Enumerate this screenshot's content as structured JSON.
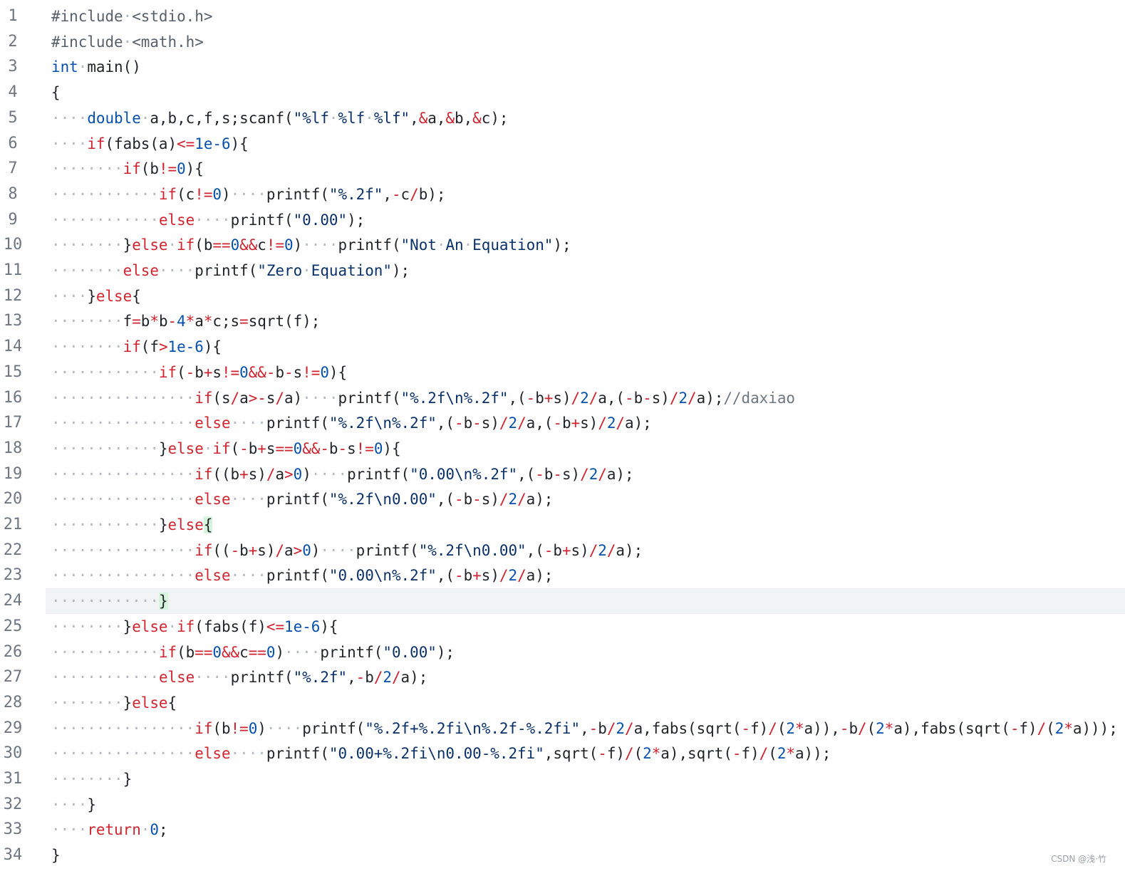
{
  "editor": {
    "highlighted_line": 24,
    "lines": [
      "#include <stdio.h>",
      "#include <math.h>",
      "int main()",
      "{",
      "    double a,b,c,f,s;scanf(\"%lf %lf %lf\",&a,&b,&c);",
      "    if(fabs(a)<=1e-6){",
      "        if(b!=0){",
      "            if(c!=0)    printf(\"%.2f\",-c/b);",
      "            else    printf(\"0.00\");",
      "        }else if(b==0&&c!=0)    printf(\"Not An Equation\");",
      "        else    printf(\"Zero Equation\");",
      "    }else{",
      "        f=b*b-4*a*c;s=sqrt(f);",
      "        if(f>1e-6){",
      "            if(-b+s!=0&&-b-s!=0){",
      "                if(s/a>-s/a)    printf(\"%.2f\\n%.2f\",(-b+s)/2/a,(-b-s)/2/a);//daxiao",
      "                else    printf(\"%.2f\\n%.2f\",(-b-s)/2/a,(-b+s)/2/a);",
      "            }else if(-b+s==0&&-b-s!=0){",
      "                if((b+s)/a>0)    printf(\"0.00\\n%.2f\",(-b-s)/2/a);",
      "                else    printf(\"%.2f\\n0.00\",(-b-s)/2/a);",
      "            }else{",
      "                if((-b+s)/a>0)    printf(\"%.2f\\n0.00\",(-b+s)/2/a);",
      "                else    printf(\"0.00\\n%.2f\",(-b+s)/2/a);",
      "            }",
      "        }else if(fabs(f)<=1e-6){",
      "            if(b==0&&c==0)    printf(\"0.00\");",
      "            else    printf(\"%.2f\",-b/2/a);",
      "        }else{",
      "                if(b!=0)    printf(\"%.2f+%.2fi\\n%.2f-%.2fi\",-b/2/a,fabs(sqrt(-f)/(2*a)),-b/(2*a),fabs(sqrt(-f)/(2*a)));",
      "                else    printf(\"0.00+%.2fi\\n0.00-%.2fi\",sqrt(-f)/(2*a),sqrt(-f)/(2*a));",
      "        }",
      "    }",
      "    return 0;",
      "}"
    ]
  },
  "watermark": "CSDN @浅·竹"
}
